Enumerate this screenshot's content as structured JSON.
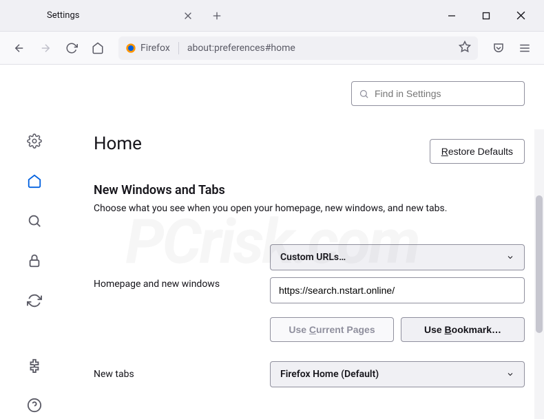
{
  "tab": {
    "title": "Settings"
  },
  "urlbar": {
    "identity": "Firefox",
    "url": "about:preferences#home"
  },
  "search": {
    "placeholder": "Find in Settings"
  },
  "page": {
    "title": "Home",
    "restore": "Restore Defaults",
    "section_title": "New Windows and Tabs",
    "section_desc": "Choose what you see when you open your homepage, new windows, and new tabs."
  },
  "homepage": {
    "label": "Homepage and new windows",
    "select_value": "Custom URLs…",
    "url_value": "https://search.nstart.online/",
    "use_current": "Use Current Pages",
    "use_bookmark": "Use Bookmark…"
  },
  "newtabs": {
    "label": "New tabs",
    "select_value": "Firefox Home (Default)"
  },
  "watermark": "PCrisk.com"
}
